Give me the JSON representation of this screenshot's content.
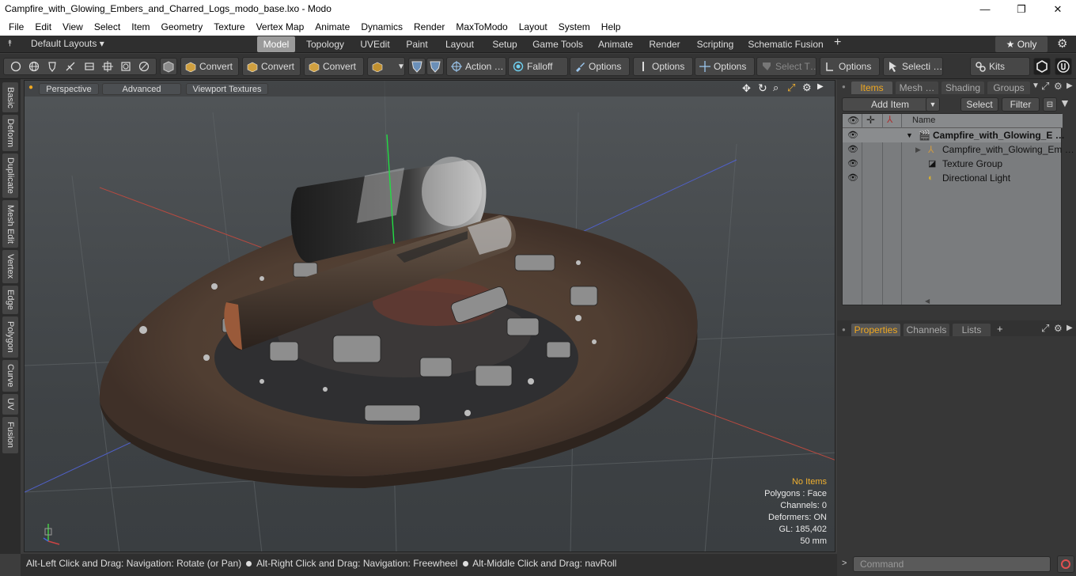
{
  "window": {
    "title": "Campfire_with_Glowing_Embers_and_Charred_Logs_modo_base.lxo - Modo",
    "minimize": "—",
    "maximize": "❐",
    "close": "✕"
  },
  "menu": [
    "File",
    "Edit",
    "View",
    "Select",
    "Item",
    "Geometry",
    "Texture",
    "Vertex Map",
    "Animate",
    "Dynamics",
    "Render",
    "MaxToModo",
    "Layout",
    "System",
    "Help"
  ],
  "layouts": {
    "dropdown": "Default Layouts ▾",
    "tabs": [
      "Model",
      "Topology",
      "UVEdit",
      "Paint",
      "Layout",
      "Setup",
      "Game Tools",
      "Animate",
      "Render",
      "Scripting",
      "Schematic Fusion"
    ],
    "active": "Model",
    "add": "+",
    "only": "★  Only",
    "gear": "⚙"
  },
  "toolbar": {
    "convert1": "Convert",
    "convert2": "Convert",
    "convert3": "Convert",
    "action": "Action …",
    "falloff": "Falloff",
    "options1": "Options",
    "options2": "Options",
    "options3": "Options",
    "select_t": "Select T…",
    "options4": "Options",
    "selecti": "Selecti …",
    "kits": "Kits"
  },
  "left_tabs": [
    "Basic",
    "Deform",
    "Duplicate",
    "Mesh Edit",
    "Vertex",
    "Edge",
    "Polygon",
    "Curve",
    "UV",
    "Fusion"
  ],
  "viewport": {
    "perspective": "Perspective",
    "advanced": "Advanced",
    "textures": "Viewport Textures",
    "info": {
      "no_items": "No Items",
      "polygons": "Polygons : Face",
      "channels": "Channels: 0",
      "deformers": "Deformers: ON",
      "gl": "GL: 185,402",
      "distance": "50 mm"
    }
  },
  "status": {
    "part1": "Alt-Left Click and Drag: Navigation: Rotate (or Pan)",
    "part2": "Alt-Right Click and Drag: Navigation: Freewheel",
    "part3": "Alt-Middle Click and Drag: navRoll"
  },
  "items_panel": {
    "tabs": [
      "Items",
      "Mesh …",
      "Shading",
      "Groups"
    ],
    "add_item": "Add Item",
    "select": "Select",
    "filter": "Filter",
    "col_name": "Name",
    "rows": [
      {
        "label": "Campfire_with_Glowing_E …",
        "bold": true
      },
      {
        "label": "Campfire_with_Glowing_Em …",
        "bold": false
      },
      {
        "label": "Texture Group",
        "bold": false
      },
      {
        "label": "Directional Light",
        "bold": false
      }
    ]
  },
  "properties_panel": {
    "tabs": [
      "Properties",
      "Channels",
      "Lists"
    ],
    "add": "+"
  },
  "command": {
    "prompt": ">",
    "placeholder": "Command"
  }
}
